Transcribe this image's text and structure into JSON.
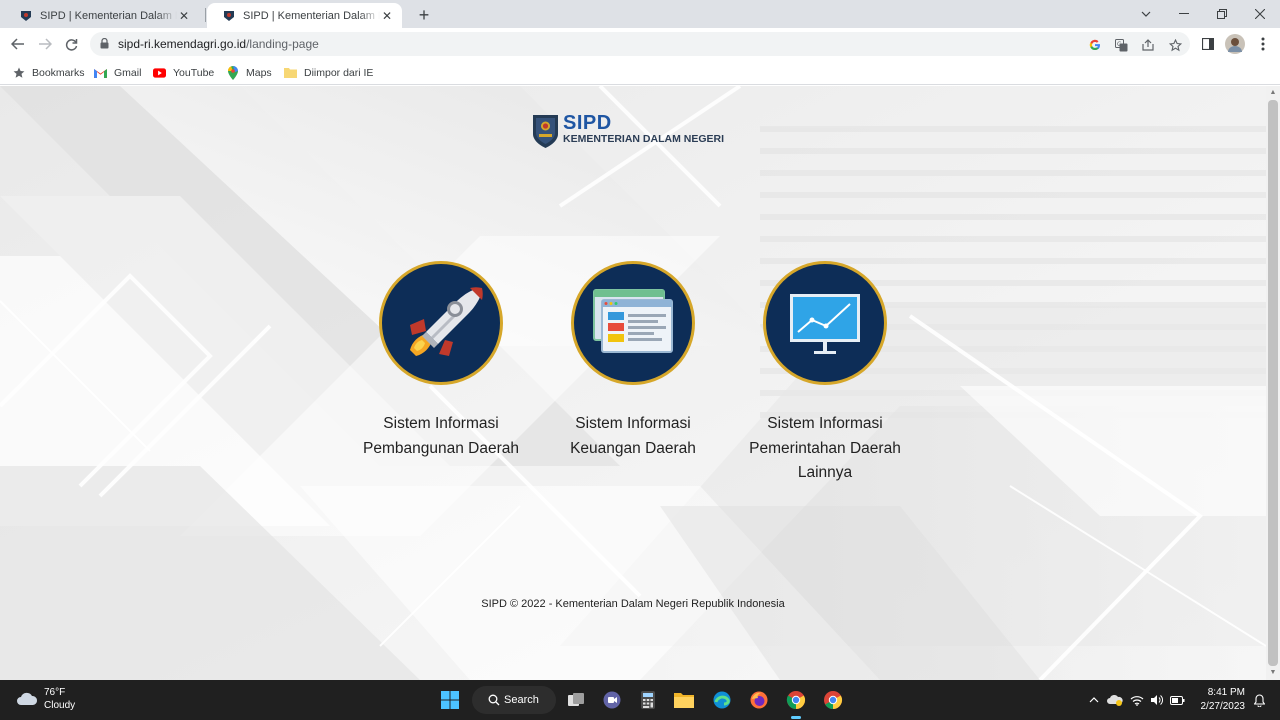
{
  "browser": {
    "tabs": [
      {
        "title": "SIPD | Kementerian Dalam Negeri",
        "active": false
      },
      {
        "title": "SIPD | Kementerian Dalam Negeri",
        "active": true
      }
    ],
    "url_host": "sipd-ri.kemendagri.go.id",
    "url_path": "/landing-page",
    "bookmarks": [
      {
        "label": "Bookmarks",
        "icon": "star-icon"
      },
      {
        "label": "Gmail",
        "icon": "gmail-icon"
      },
      {
        "label": "YouTube",
        "icon": "youtube-icon"
      },
      {
        "label": "Maps",
        "icon": "maps-icon"
      },
      {
        "label": "Diimpor dari IE",
        "icon": "folder-icon"
      }
    ]
  },
  "page": {
    "logo": {
      "name": "SIPD",
      "subtitle": "KEMENTERIAN DALAM NEGERI"
    },
    "cards": [
      {
        "line1": "Sistem Informasi",
        "line2": "Pembangunan Daerah",
        "line3": "",
        "icon": "rocket-icon"
      },
      {
        "line1": "Sistem Informasi",
        "line2": "Keuangan Daerah",
        "line3": "",
        "icon": "browser-windows-icon"
      },
      {
        "line1": "Sistem Informasi",
        "line2": "Pemerintahan Daerah",
        "line3": "Lainnya",
        "icon": "monitor-chart-icon"
      }
    ],
    "footer": "SIPD © 2022 - Kementerian Dalam Negeri Republik Indonesia"
  },
  "taskbar": {
    "weather_temp": "76°F",
    "weather_desc": "Cloudy",
    "search_label": "Search",
    "time": "8:41 PM",
    "date": "2/27/2023"
  },
  "colors": {
    "circle_bg": "#0d2d57",
    "circle_border": "#d6a72a",
    "logo_blue": "#1f56a3"
  }
}
